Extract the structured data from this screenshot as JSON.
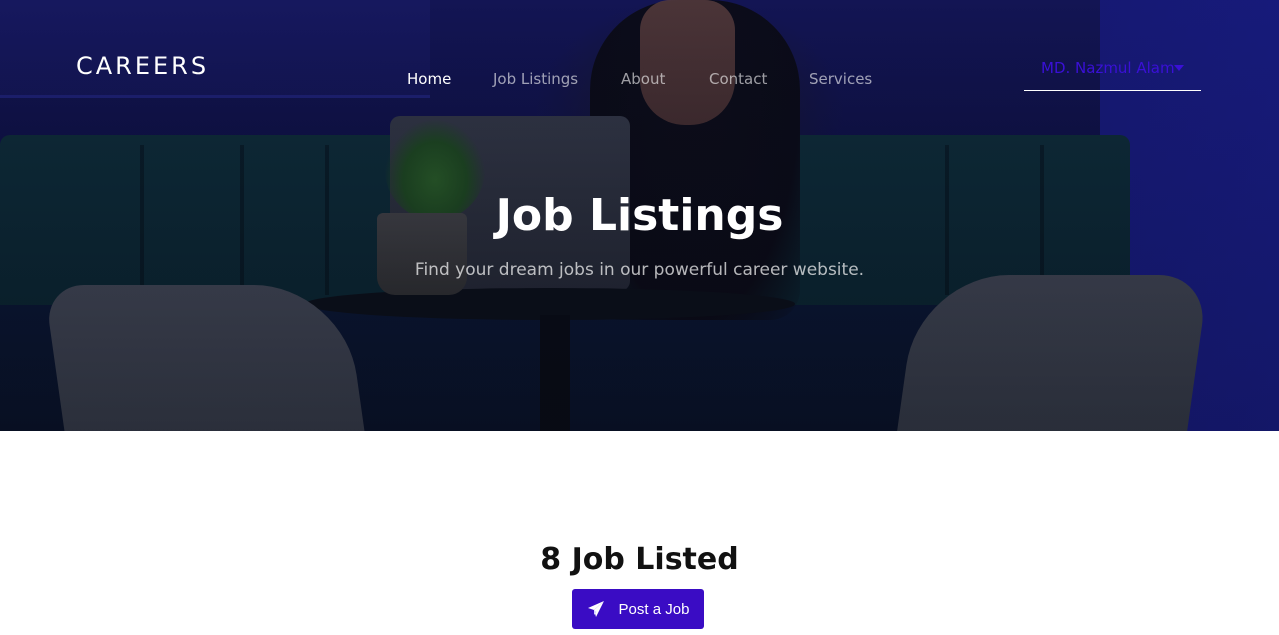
{
  "brand": "CAREERS",
  "nav": {
    "items": [
      {
        "label": "Home",
        "active": true
      },
      {
        "label": "Job Listings",
        "active": false
      },
      {
        "label": "About",
        "active": false
      },
      {
        "label": "Contact",
        "active": false
      },
      {
        "label": "Services",
        "active": false
      }
    ]
  },
  "user": {
    "name": "MD. Nazmul Alam",
    "icon": "caret-down-icon"
  },
  "hero": {
    "title": "Job Listings",
    "subtitle": "Find your dream jobs in our powerful career website."
  },
  "main": {
    "count_title": "8 Job Listed",
    "post_button": {
      "label": "Post a Job",
      "icon": "paper-plane-icon"
    }
  },
  "colors": {
    "accent": "#3a0cc4",
    "user_link": "#3a10d6"
  }
}
